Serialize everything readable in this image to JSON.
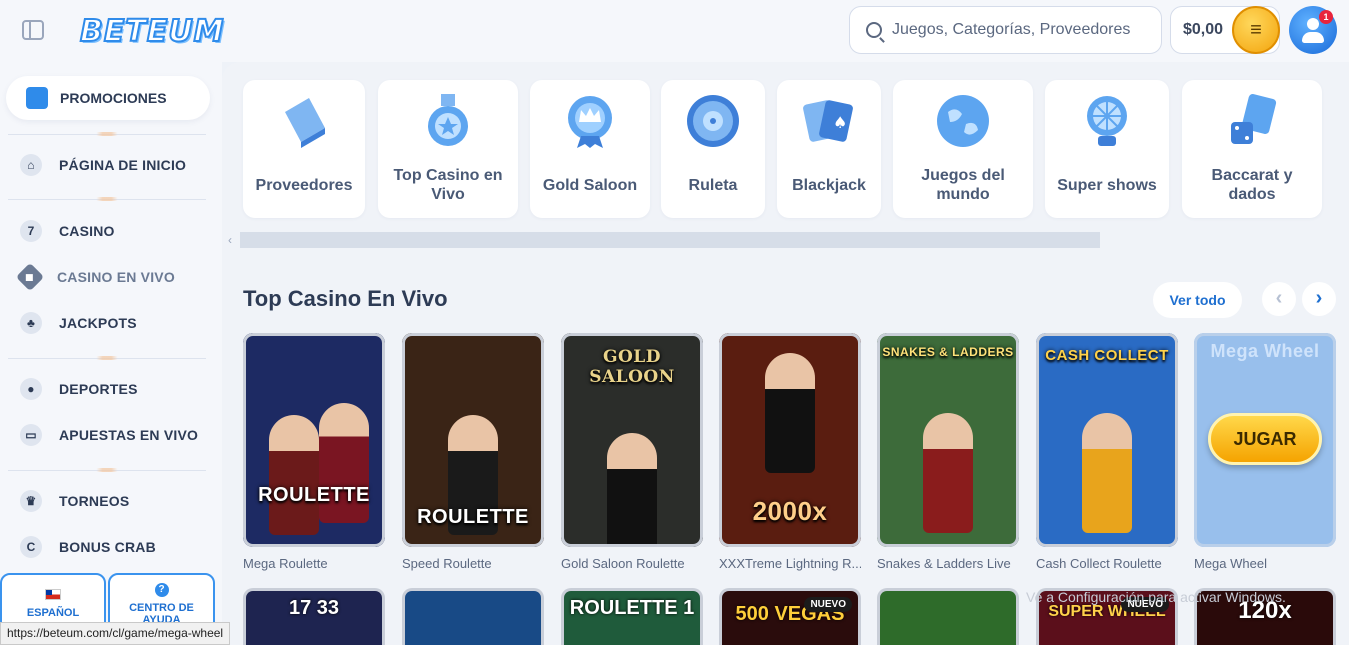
{
  "header": {
    "logo": "BETEUM",
    "search_placeholder": "Juegos, Categorías, Proveedores",
    "balance": "$0,00",
    "notification_count": "1"
  },
  "sidebar": {
    "promo": "PROMOCIONES",
    "items": [
      {
        "label": "PÁGINA DE INICIO",
        "icon": "home-icon"
      },
      {
        "label": "CASINO",
        "icon": "seven-icon"
      },
      {
        "label": "CASINO EN VIVO",
        "icon": "chip-icon"
      },
      {
        "label": "JACKPOTS",
        "icon": "clover-icon"
      },
      {
        "label": "DEPORTES",
        "icon": "soccer-ball-icon"
      },
      {
        "label": "APUESTAS EN VIVO",
        "icon": "live-tv-icon"
      },
      {
        "label": "TORNEOS",
        "icon": "trophy-icon"
      },
      {
        "label": "BONUS CRAB",
        "icon": "crab-claw-icon"
      }
    ],
    "language": "ESPAÑOL",
    "help": "CENTRO DE AYUDA"
  },
  "categories": [
    {
      "label": "Proveedores",
      "icon": "book-icon"
    },
    {
      "label": "Top Casino en Vivo",
      "icon": "medal-icon"
    },
    {
      "label": "Gold Saloon",
      "icon": "crown-badge-icon"
    },
    {
      "label": "Ruleta",
      "icon": "roulette-icon"
    },
    {
      "label": "Blackjack",
      "icon": "cards-icon"
    },
    {
      "label": "Juegos del mundo",
      "icon": "globe-icon"
    },
    {
      "label": "Super shows",
      "icon": "wheel-icon"
    },
    {
      "label": "Baccarat y dados",
      "icon": "dice-icon"
    }
  ],
  "section": {
    "title": "Top Casino En Vivo",
    "view_all": "Ver todo"
  },
  "games": [
    {
      "name": "Mega Roulette",
      "tile_text": "ROULETTE",
      "bg": "#1d2a63"
    },
    {
      "name": "Speed Roulette",
      "tile_text": "ROULETTE",
      "bg": "#3a2416"
    },
    {
      "name": "Gold Saloon Roulette",
      "tile_text": "GOLD SALOON",
      "bg": "#2b2d2a"
    },
    {
      "name": "XXXTreme Lightning R...",
      "tile_text": "2000x",
      "bg": "#5a1d10"
    },
    {
      "name": "Snakes & Ladders Live",
      "tile_text": "SNAKES & LADDERS",
      "bg": "#3d6b3a"
    },
    {
      "name": "Cash Collect Roulette",
      "tile_text": "CASH COLLECT",
      "bg": "#2a6bc4"
    },
    {
      "name": "Mega Wheel",
      "tile_text": "Mega Wheel",
      "bg": "#8eb9ea"
    }
  ],
  "play_button": "JUGAR",
  "row2": [
    {
      "text": "17 33",
      "bg": "#1e2450",
      "badge": ""
    },
    {
      "text": "",
      "bg": "#184a86",
      "badge": ""
    },
    {
      "text": "ROULETTE 1",
      "bg": "#1f5b3b",
      "badge": ""
    },
    {
      "text": "500 VEGAS",
      "bg": "#2a0c0c",
      "badge": "NUEVO"
    },
    {
      "text": "",
      "bg": "#2e6b2a",
      "badge": ""
    },
    {
      "text": "SUPER WHEEL",
      "bg": "#5b0f1b",
      "badge": "NUEVO"
    },
    {
      "text": "120x",
      "bg": "#2a0a0a",
      "badge": ""
    }
  ],
  "watermark": "Ve a Configuración para activar Windows.",
  "status_url": "https://beteum.com/cl/game/mega-wheel"
}
